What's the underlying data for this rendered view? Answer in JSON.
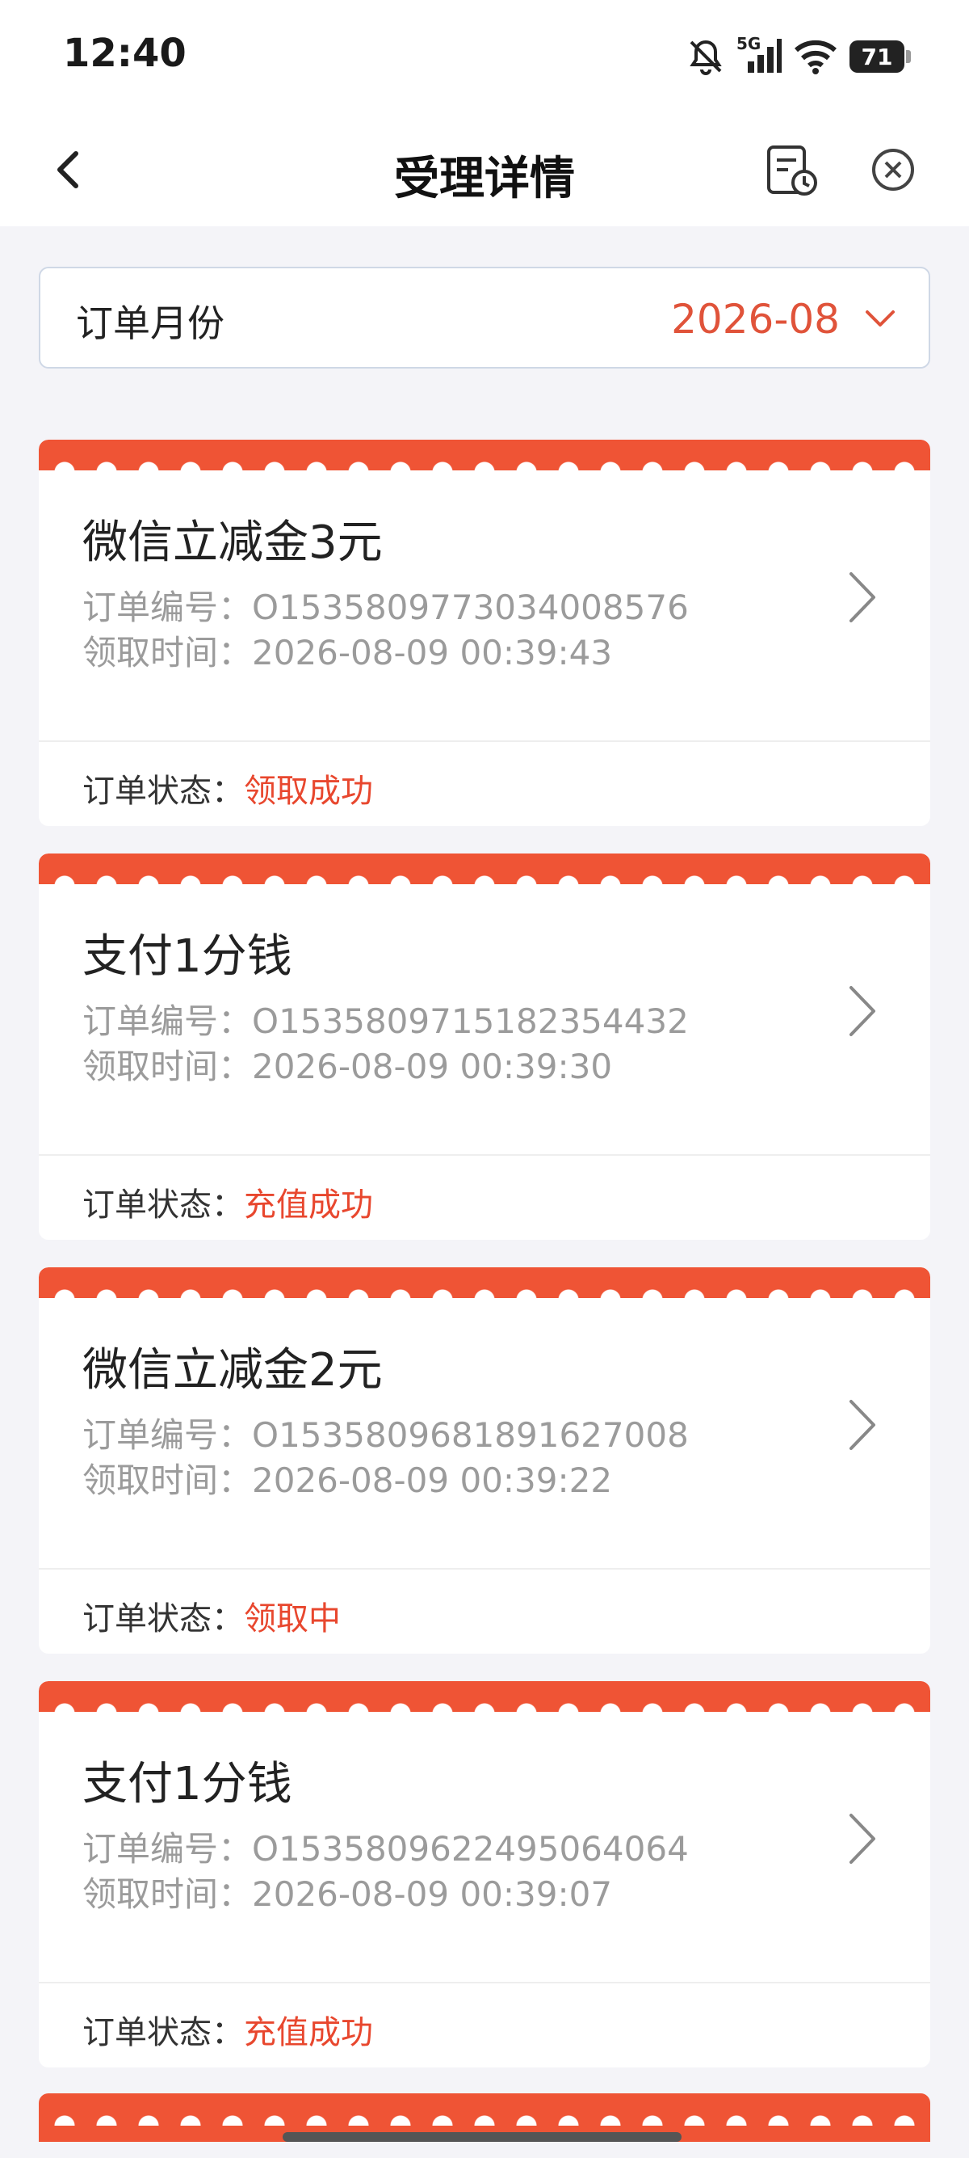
{
  "status_bar": {
    "time": "12:40",
    "network": "5G",
    "battery": "71"
  },
  "nav": {
    "title": "受理详情"
  },
  "month_filter": {
    "label": "订单月份",
    "value": "2026-08"
  },
  "orders": [
    {
      "title": "微信立减金3元",
      "order_no_label": "订单编号：",
      "order_no": "O1535809773034008576",
      "time_label": "领取时间：",
      "time": "2026-08-09 00:39:43",
      "status_label": "订单状态：",
      "status": "领取成功"
    },
    {
      "title": "支付1分钱",
      "order_no_label": "订单编号：",
      "order_no": "O1535809715182354432",
      "time_label": "领取时间：",
      "time": "2026-08-09 00:39:30",
      "status_label": "订单状态：",
      "status": "充值成功"
    },
    {
      "title": "微信立减金2元",
      "order_no_label": "订单编号：",
      "order_no": "O1535809681891627008",
      "time_label": "领取时间：",
      "time": "2026-08-09 00:39:22",
      "status_label": "订单状态：",
      "status": "领取中"
    },
    {
      "title": "支付1分钱",
      "order_no_label": "订单编号：",
      "order_no": "O1535809622495064064",
      "time_label": "领取时间：",
      "time": "2026-08-09 00:39:07",
      "status_label": "订单状态：",
      "status": "充值成功"
    }
  ],
  "colors": {
    "accent": "#ef5435",
    "status_text": "#e8472e",
    "month_value": "#e0533a"
  }
}
